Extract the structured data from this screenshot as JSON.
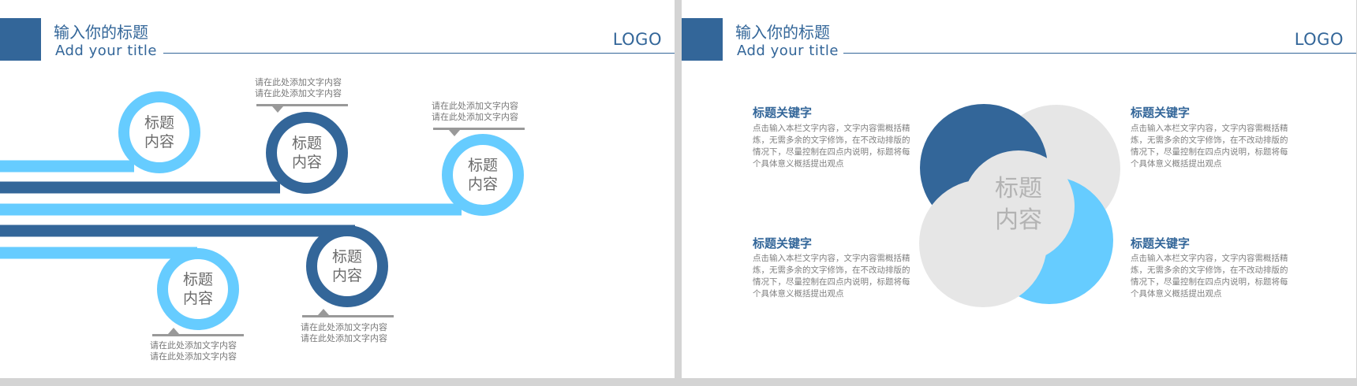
{
  "header": {
    "title_cn": "输入你的标题",
    "title_en": "Add your title",
    "logo": "LOGO"
  },
  "timeline": {
    "nodes": [
      {
        "line1": "标题",
        "line2": "内容"
      },
      {
        "line1": "标题",
        "line2": "内容"
      },
      {
        "line1": "标题",
        "line2": "内容"
      },
      {
        "line1": "标题",
        "line2": "内容"
      },
      {
        "line1": "标题",
        "line2": "内容"
      }
    ],
    "captions": [
      {
        "line1": "请在此处添加文字内容",
        "line2": "请在此处添加文字内容"
      },
      {
        "line1": "请在此处添加文字内容",
        "line2": "请在此处添加文字内容"
      },
      {
        "line1": "请在此处添加文字内容",
        "line2": "请在此处添加文字内容"
      },
      {
        "line1": "请在此处添加文字内容",
        "line2": "请在此处添加文字内容"
      }
    ]
  },
  "venn": {
    "center": {
      "line1": "标题",
      "line2": "内容"
    },
    "keywords": [
      {
        "title": "标题关键字",
        "body": "点击输入本栏文字内容，文字内容需概括精炼，无需多余的文字修饰，在不改动排版的情况下，尽量控制在四点内说明，标题将每个具体意义概括提出观点"
      },
      {
        "title": "标题关键字",
        "body": "点击输入本栏文字内容，文字内容需概括精炼，无需多余的文字修饰，在不改动排版的情况下，尽量控制在四点内说明，标题将每个具体意义概括提出观点"
      },
      {
        "title": "标题关键字",
        "body": "点击输入本栏文字内容，文字内容需概括精炼，无需多余的文字修饰，在不改动排版的情况下，尽量控制在四点内说明，标题将每个具体意义概括提出观点"
      },
      {
        "title": "标题关键字",
        "body": "点击输入本栏文字内容，文字内容需概括精炼，无需多余的文字修饰，在不改动排版的情况下，尽量控制在四点内说明，标题将每个具体意义概括提出观点"
      }
    ]
  },
  "colors": {
    "dark_blue": "#336699",
    "light_blue": "#66ccff",
    "light_gray": "#e6e6e6",
    "caption_bar": "#999999"
  }
}
